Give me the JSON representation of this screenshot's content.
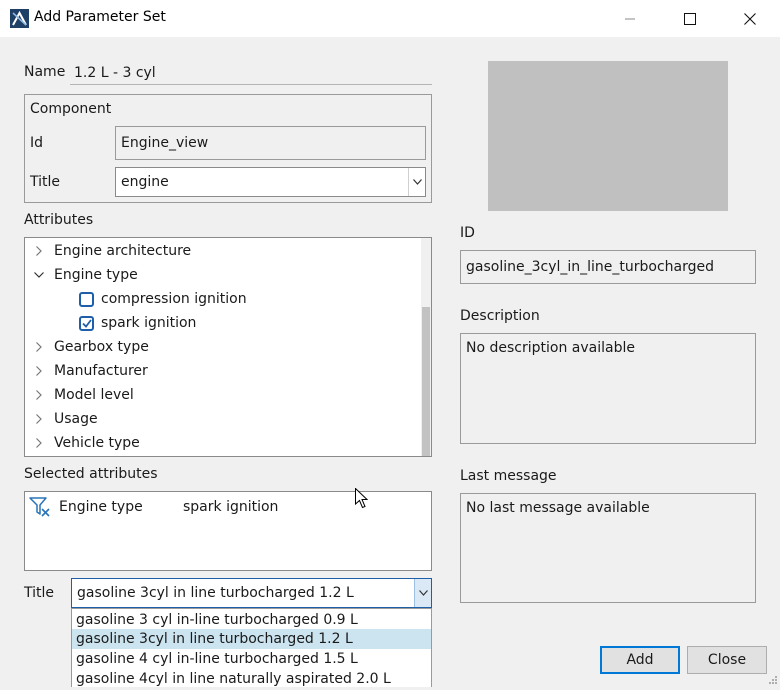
{
  "window": {
    "title": "Add Parameter Set"
  },
  "name": {
    "label": "Name",
    "value": "1.2 L - 3 cyl"
  },
  "component": {
    "heading": "Component",
    "id_label": "Id",
    "id_value": "Engine_view",
    "title_label": "Title",
    "title_value": "engine"
  },
  "attributes": {
    "label": "Attributes",
    "items": [
      {
        "label": "Engine architecture",
        "expanded": false
      },
      {
        "label": "Engine type",
        "expanded": true
      },
      {
        "label": "compression ignition",
        "checked": false
      },
      {
        "label": "spark ignition",
        "checked": true
      },
      {
        "label": "Gearbox type",
        "expanded": false
      },
      {
        "label": "Manufacturer",
        "expanded": false
      },
      {
        "label": "Model level",
        "expanded": false
      },
      {
        "label": "Usage",
        "expanded": false
      },
      {
        "label": "Vehicle type",
        "expanded": false
      }
    ]
  },
  "selected_attributes": {
    "label": "Selected attributes",
    "rows": [
      {
        "attribute": "Engine type",
        "value": "spark ignition"
      }
    ]
  },
  "title_select": {
    "label": "Title",
    "value": "gasoline 3cyl in line turbocharged 1.2 L",
    "options": [
      "gasoline 3 cyl in-line turbocharged 0.9 L",
      "gasoline 3cyl in line turbocharged 1.2 L",
      "gasoline 4 cyl in-line turbocharged 1.5 L",
      "gasoline 4cyl in line naturally aspirated 2.0 L"
    ],
    "selected_index": 1
  },
  "right_panel": {
    "id_label": "ID",
    "id_value": "gasoline_3cyl_in_line_turbocharged",
    "description_label": "Description",
    "description_value": "No description available",
    "last_message_label": "Last message",
    "last_message_value": "No last message available"
  },
  "buttons": {
    "add": "Add",
    "close": "Close"
  },
  "colors": {
    "accent": "#1f5fa8",
    "selection": "#cce4f0",
    "preview": "#c0c0c0"
  }
}
